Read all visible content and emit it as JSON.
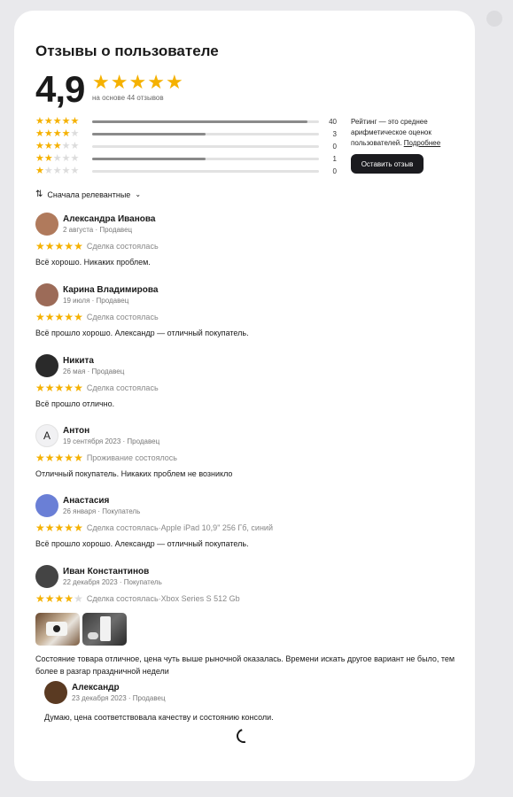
{
  "page": {
    "title": "Отзывы о пользователе",
    "rating": "4,9",
    "based_on": "на основе 44 отзывов"
  },
  "distribution": [
    {
      "stars": 5,
      "count": "40",
      "fraction": 0.95
    },
    {
      "stars": 4,
      "count": "3",
      "fraction": 0.5
    },
    {
      "stars": 3,
      "count": "0",
      "fraction": 0
    },
    {
      "stars": 2,
      "count": "1",
      "fraction": 0.5
    },
    {
      "stars": 1,
      "count": "0",
      "fraction": 0
    }
  ],
  "side": {
    "note": "Рейтинг — это среднее арифметическое оценок пользователей.",
    "more_link": "Подробнее",
    "leave_button": "Оставить отзыв"
  },
  "sort": {
    "label": "Сначала релевантные"
  },
  "reviews": [
    {
      "name": "Александра Иванова",
      "date": "2 августа",
      "role": "Продавец",
      "stars": 5,
      "deal": "Сделка состоялась",
      "item": "",
      "text": "Всё хорошо. Никаких проблем.",
      "avatar_color": "#b07a5c",
      "avatar_letter": ""
    },
    {
      "name": "Карина Владимирова",
      "date": "19 июля",
      "role": "Продавец",
      "stars": 5,
      "deal": "Сделка состоялась",
      "item": "",
      "text": "Всё прошло хорошо. Александр — отличный покупатель.",
      "avatar_color": "#9c6b58",
      "avatar_letter": ""
    },
    {
      "name": "Никита",
      "date": "26 мая",
      "role": "Продавец",
      "stars": 5,
      "deal": "Сделка состоялась",
      "item": "",
      "text": "Всё прошло отлично.",
      "avatar_color": "#2a2a2a",
      "avatar_letter": ""
    },
    {
      "name": "Антон",
      "date": "19 сентября 2023",
      "role": "Продавец",
      "stars": 5,
      "deal": "Проживание состоялось",
      "item": "",
      "text": "Отличный покупатель. Никаких проблем не возникло",
      "avatar_color": "#f1f1f3",
      "avatar_letter": "А"
    },
    {
      "name": "Анастасия",
      "date": "26 января",
      "role": "Покупатель",
      "stars": 5,
      "deal": "Сделка состоялась",
      "item": "Apple iPad 10,9\" 256 Гб, синий",
      "text": "Всё прошло хорошо. Александр — отличный покупатель.",
      "avatar_color": "#6a7fd6",
      "avatar_letter": ""
    },
    {
      "name": "Иван Константинов",
      "date": "22 декабря 2023",
      "role": "Покупатель",
      "stars": 4,
      "deal": "Сделка состоялась",
      "item": "Xbox Series S 512 Gb",
      "text": "Состояние товара отличное, цена чуть выше рыночной оказалась. Времени искать другое вариант не было, тем более в разгар праздничной недели",
      "avatar_color": "#444444",
      "avatar_letter": ""
    }
  ],
  "reply": {
    "name": "Александр",
    "date": "23 декабря 2023",
    "role": "Продавец",
    "text": "Думаю, цена соответствовала качеству и состоянию консоли.",
    "avatar_color": "#5a3a22"
  },
  "separator": " · ",
  "colors": {
    "star": "#f5b100",
    "button": "#1b1b1f",
    "bar_fill": "#8a8a8a"
  }
}
